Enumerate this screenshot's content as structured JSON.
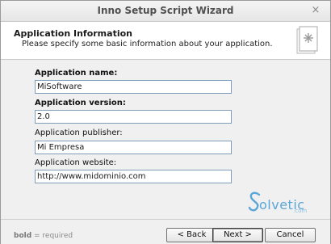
{
  "window": {
    "title": "Inno Setup Script Wizard",
    "close_glyph": "×"
  },
  "header": {
    "title": "Application Information",
    "subtitle": "Please specify some basic information about your application."
  },
  "form": {
    "name_label": "Application name:",
    "name_value": "MiSoftware",
    "version_label": "Application version:",
    "version_value": "2.0",
    "publisher_label": "Application publisher:",
    "publisher_value": "Mi Empresa",
    "website_label": "Application website:",
    "website_value": "http://www.midominio.com"
  },
  "watermark": {
    "text": "olvetic",
    "suffix": ".com"
  },
  "footer": {
    "hint_bold": "bold",
    "hint_rest": " = required",
    "back_label": "< Back",
    "next_label": "Next >",
    "cancel_label": "Cancel"
  },
  "colors": {
    "watermark": "#5aa6d8",
    "field_border": "#7f9db9"
  }
}
